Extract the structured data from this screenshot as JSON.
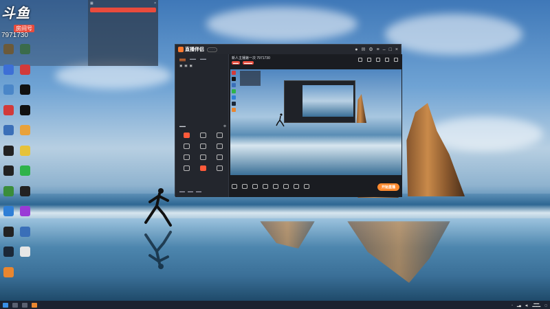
{
  "stream": {
    "logo": "斗鱼",
    "room_label": "房间号",
    "room_id": "7971730"
  },
  "app": {
    "title": "直播伴侣",
    "stream_title_prefix": "新人主播第一次",
    "stream_room": "7971730",
    "live_button": "开始直播"
  },
  "desktop_icons": [
    {
      "label": "",
      "icon": "game-icon",
      "color": "#6b5a3a"
    },
    {
      "label": "",
      "icon": "app-icon",
      "color": "#3a6b4b"
    },
    {
      "label": "",
      "icon": "doc-icon",
      "color": "#3d6fd6"
    },
    {
      "label": "",
      "icon": "video-icon",
      "color": "#d23a3a"
    },
    {
      "label": "",
      "icon": "monitor-icon",
      "color": "#4a86c8"
    },
    {
      "label": "",
      "icon": "tiktok-icon",
      "color": "#111111"
    },
    {
      "label": "",
      "icon": "wps-icon",
      "color": "#d23a3a"
    },
    {
      "label": "",
      "icon": "capcut-icon",
      "color": "#111111"
    },
    {
      "label": "",
      "icon": "mascot-icon",
      "color": "#3a6fb8"
    },
    {
      "label": "",
      "icon": "dog-icon",
      "color": "#e9a23a"
    },
    {
      "label": "",
      "icon": "ps-icon",
      "color": "#222222"
    },
    {
      "label": "",
      "icon": "flower-icon",
      "color": "#e6c23a"
    },
    {
      "label": "",
      "icon": "qq-icon",
      "color": "#222222"
    },
    {
      "label": "",
      "icon": "iqiyi-icon",
      "color": "#2fb34a"
    },
    {
      "label": "",
      "icon": "chrome-icon",
      "color": "#3a8d3a"
    },
    {
      "label": "",
      "icon": "epic-icon",
      "color": "#222222"
    },
    {
      "label": "",
      "icon": "edge-icon",
      "color": "#2f7fd6"
    },
    {
      "label": "",
      "icon": "purple-app-icon",
      "color": "#9a3ad6"
    },
    {
      "label": "",
      "icon": "obs-icon",
      "color": "#222222"
    },
    {
      "label": "",
      "icon": "globe-icon",
      "color": "#3a6fb8"
    },
    {
      "label": "",
      "icon": "steam-icon",
      "color": "#1b2838"
    },
    {
      "label": "",
      "icon": "file-icon",
      "color": "#e6e6e6"
    },
    {
      "label": "",
      "icon": "orange-app-icon",
      "color": "#e9862f"
    }
  ],
  "colors": {
    "accent": "#ff7a2f",
    "red": "#e94b3c"
  }
}
